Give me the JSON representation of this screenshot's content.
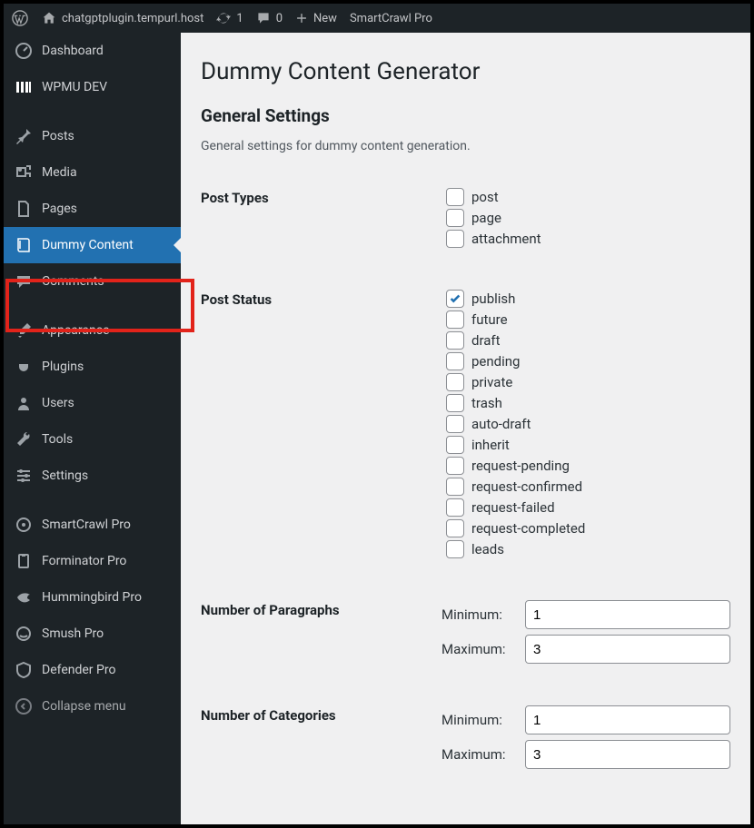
{
  "topbar": {
    "site_name": "chatgptplugin.tempurl.host",
    "updates_count": "1",
    "comments_count": "0",
    "new_label": "New",
    "smartcrawl_label": "SmartCrawl Pro"
  },
  "sidebar": {
    "items": [
      {
        "id": "dashboard",
        "label": "Dashboard"
      },
      {
        "id": "wpmudev",
        "label": "WPMU DEV"
      },
      {
        "id": "posts",
        "label": "Posts"
      },
      {
        "id": "media",
        "label": "Media"
      },
      {
        "id": "pages",
        "label": "Pages"
      },
      {
        "id": "dummy-content",
        "label": "Dummy Content"
      },
      {
        "id": "comments",
        "label": "Comments"
      },
      {
        "id": "appearance",
        "label": "Appearance"
      },
      {
        "id": "plugins",
        "label": "Plugins"
      },
      {
        "id": "users",
        "label": "Users"
      },
      {
        "id": "tools",
        "label": "Tools"
      },
      {
        "id": "settings",
        "label": "Settings"
      },
      {
        "id": "smartcrawl",
        "label": "SmartCrawl Pro"
      },
      {
        "id": "forminator",
        "label": "Forminator Pro"
      },
      {
        "id": "hummingbird",
        "label": "Hummingbird Pro"
      },
      {
        "id": "smush",
        "label": "Smush Pro"
      },
      {
        "id": "defender",
        "label": "Defender Pro"
      }
    ],
    "collapse_label": "Collapse menu"
  },
  "page": {
    "title": "Dummy Content Generator",
    "section_title": "General Settings",
    "section_desc": "General settings for dummy content generation.",
    "post_types_label": "Post Types",
    "post_types": [
      {
        "name": "post",
        "checked": false
      },
      {
        "name": "page",
        "checked": false
      },
      {
        "name": "attachment",
        "checked": false
      }
    ],
    "post_status_label": "Post Status",
    "post_status": [
      {
        "name": "publish",
        "checked": true
      },
      {
        "name": "future",
        "checked": false
      },
      {
        "name": "draft",
        "checked": false
      },
      {
        "name": "pending",
        "checked": false
      },
      {
        "name": "private",
        "checked": false
      },
      {
        "name": "trash",
        "checked": false
      },
      {
        "name": "auto-draft",
        "checked": false
      },
      {
        "name": "inherit",
        "checked": false
      },
      {
        "name": "request-pending",
        "checked": false
      },
      {
        "name": "request-confirmed",
        "checked": false
      },
      {
        "name": "request-failed",
        "checked": false
      },
      {
        "name": "request-completed",
        "checked": false
      },
      {
        "name": "leads",
        "checked": false
      }
    ],
    "num_paragraphs_label": "Number of Paragraphs",
    "num_categories_label": "Number of Categories",
    "min_label": "Minimum:",
    "max_label": "Maximum:",
    "paragraphs_min": "1",
    "paragraphs_max": "3",
    "categories_min": "1",
    "categories_max": "3"
  }
}
